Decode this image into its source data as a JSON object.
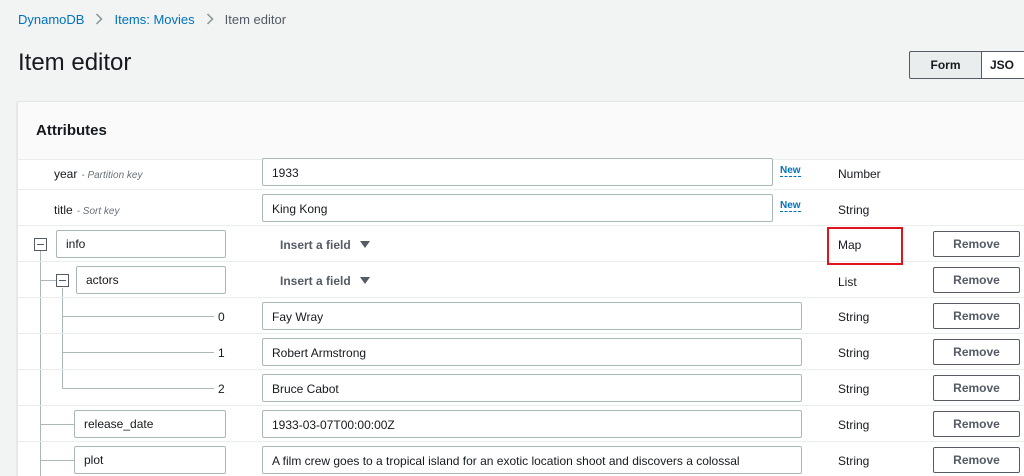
{
  "breadcrumb": {
    "items": [
      "DynamoDB",
      "Items: Movies"
    ],
    "current": "Item editor"
  },
  "page_title": "Item editor",
  "view_toggle": {
    "form_label": "Form",
    "json_label": "JSO"
  },
  "panel": {
    "title": "Attributes"
  },
  "rows": {
    "year": {
      "name": "year",
      "key": "- Partition key",
      "value": "1933",
      "new_label": "New",
      "type": "Number"
    },
    "title": {
      "name": "title",
      "key": "- Sort key",
      "value": "King Kong",
      "new_label": "New",
      "type": "String"
    },
    "info": {
      "name": "info",
      "insert_label": "Insert a field",
      "type": "Map",
      "remove_label": "Remove"
    },
    "actors": {
      "name": "actors",
      "insert_label": "Insert a field",
      "type": "List",
      "remove_label": "Remove"
    },
    "actor0": {
      "index": "0",
      "value": "Fay Wray",
      "type": "String",
      "remove_label": "Remove"
    },
    "actor1": {
      "index": "1",
      "value": "Robert Armstrong",
      "type": "String",
      "remove_label": "Remove"
    },
    "actor2": {
      "index": "2",
      "value": "Bruce Cabot",
      "type": "String",
      "remove_label": "Remove"
    },
    "release_date": {
      "name": "release_date",
      "value": "1933-03-07T00:00:00Z",
      "type": "String",
      "remove_label": "Remove"
    },
    "plot": {
      "name": "plot",
      "value": "A film crew goes to a tropical island for an exotic location shoot and discovers a colossal",
      "type": "String",
      "remove_label": "Remove"
    }
  },
  "colors": {
    "link": "#0073bb",
    "highlight": "#e0141e"
  }
}
